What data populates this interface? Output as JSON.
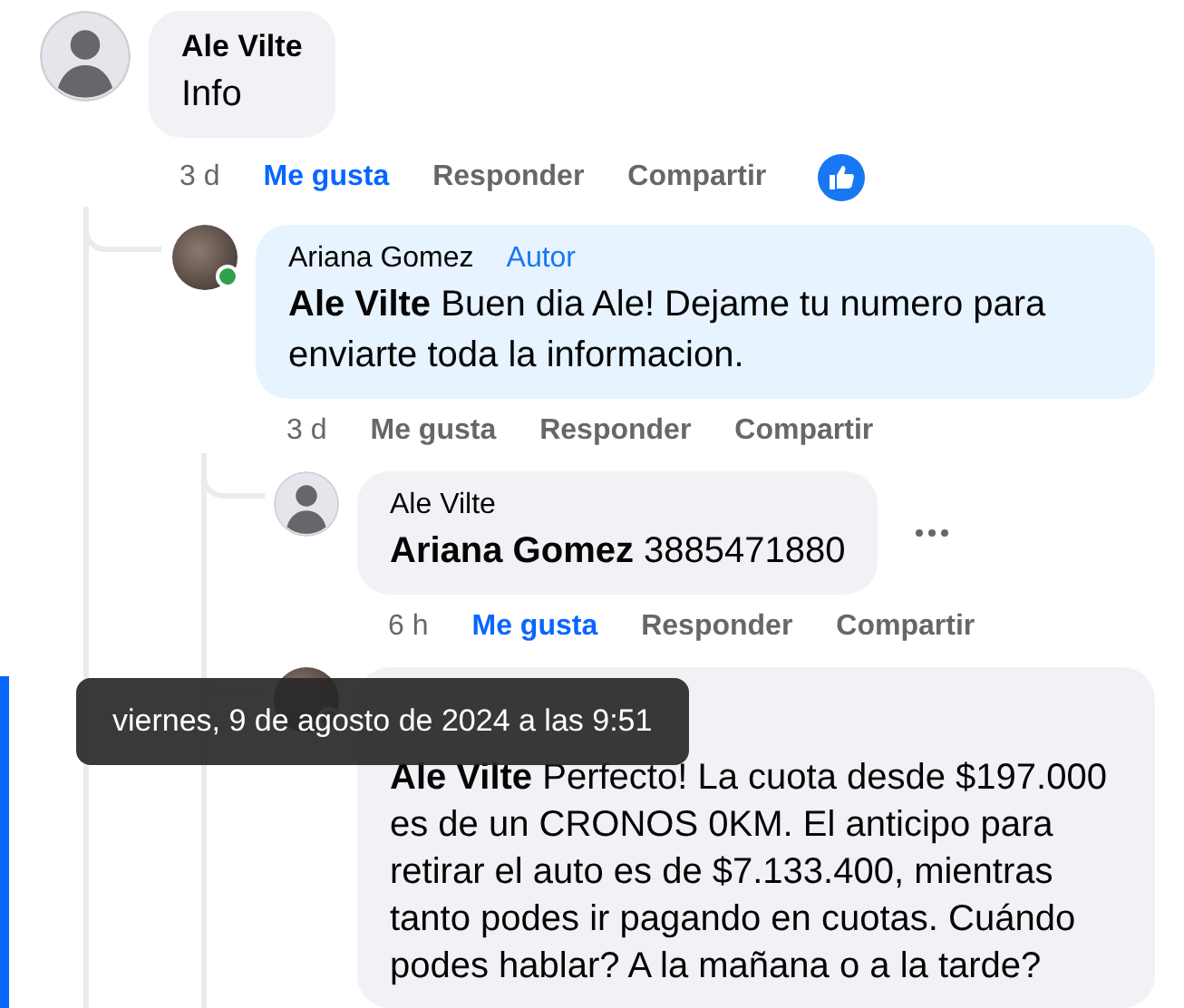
{
  "comments": [
    {
      "author": "Ale Vilte",
      "photo": false,
      "online": false,
      "text": "Info",
      "time": "3 d",
      "like": "Me gusta",
      "liked": true,
      "reply": "Responder",
      "share": "Compartir",
      "reacted": true,
      "more_menu": false,
      "children": [
        {
          "author": "Ariana Gomez",
          "badge": "Autor",
          "photo": true,
          "online": true,
          "mention": "Ale Vilte",
          "text": "Buen dia Ale! Dejame tu numero para enviarte toda la informacion.",
          "time": "3 d",
          "like": "Me gusta",
          "liked": false,
          "reply": "Responder",
          "share": "Compartir",
          "more_menu": false,
          "children": [
            {
              "author": "Ale Vilte",
              "photo": false,
              "online": false,
              "mention": "Ariana Gomez",
              "text": "3885471880",
              "time": "6 h",
              "like": "Me gusta",
              "liked": true,
              "reply": "Responder",
              "share": "Compartir",
              "more_menu": true
            },
            {
              "photo": true,
              "online": true,
              "mention": "Ale Vilte",
              "text": "Perfecto! La cuota desde $197.000 es de un CRONOS 0KM. El anticipo para retirar el auto es de $7.133.400, mientras tanto podes ir pagando en cuotas. Cuándo podes hablar? A la mañana o a la tarde?",
              "more_menu": false
            }
          ]
        }
      ]
    }
  ],
  "tooltip": "viernes, 9 de agosto de 2024 a las 9:51"
}
